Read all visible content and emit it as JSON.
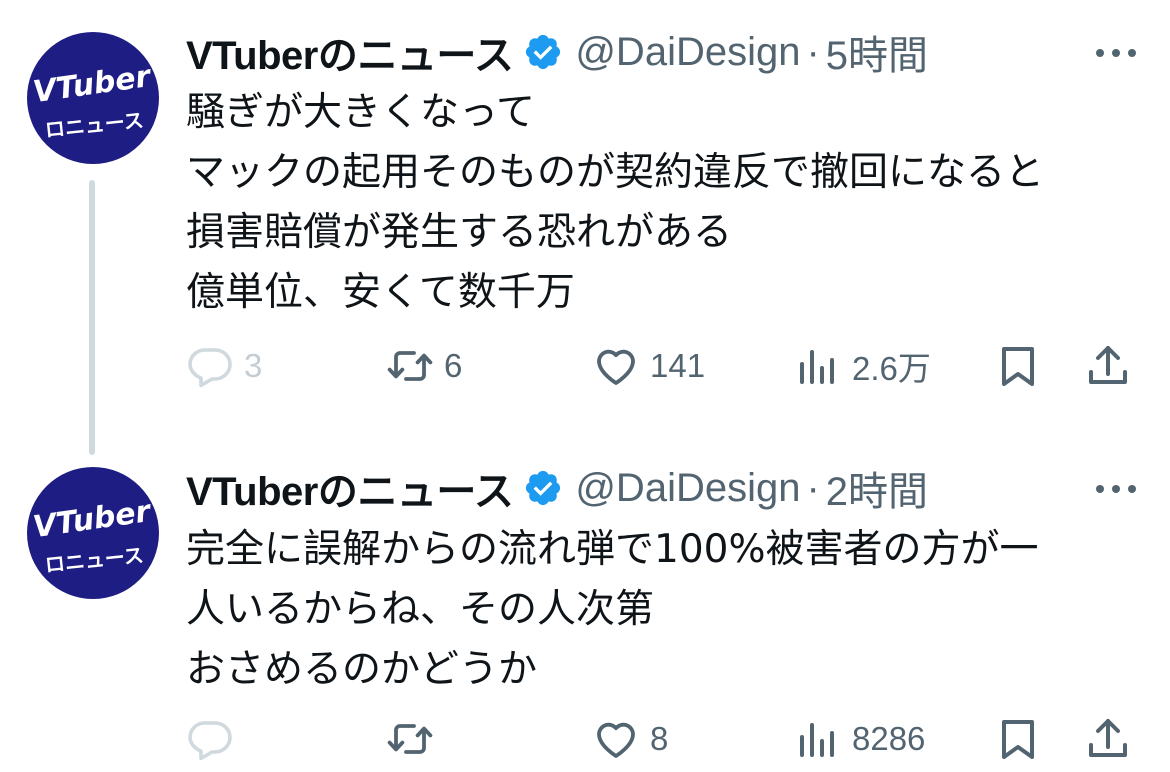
{
  "tweets": [
    {
      "avatar_text": {
        "line1": "VTuber",
        "line2": "ロニュース"
      },
      "author_name": "VTuberのニュース",
      "handle": "@DaiDesign",
      "separator": "·",
      "time": "5時間",
      "text_lines": [
        "騒ぎが大きくなって",
        "マックの起用そのものが契約違反で撤回になると",
        "損害賠償が発生する恐れがある",
        "億単位、安くて数千万"
      ],
      "actions": {
        "replies": "3",
        "retweets": "6",
        "likes": "141",
        "views": "2.6万"
      }
    },
    {
      "avatar_text": {
        "line1": "VTuber",
        "line2": "ロニュース"
      },
      "author_name": "VTuberのニュース",
      "handle": "@DaiDesign",
      "separator": "·",
      "time": "2時間",
      "text_lines": [
        "完全に誤解からの流れ弾で100%被害者の方が一",
        "人いるからね、その人次第",
        "おさめるのかどうか"
      ],
      "actions": {
        "replies": "",
        "retweets": "",
        "likes": "8",
        "views": "8286"
      }
    }
  ],
  "icons": {
    "verified": "verified-badge-icon",
    "more": "more-dots-icon",
    "reply": "reply-bubble-icon",
    "retweet": "retweet-icon",
    "like": "heart-icon",
    "views": "views-chart-icon",
    "bookmark": "bookmark-icon",
    "share": "share-icon"
  },
  "colors": {
    "text_primary": "#0f1419",
    "text_secondary": "#536471",
    "verified_blue": "#1d9bf0",
    "avatar_bg": "#1e1d84",
    "thread_line": "#cfd9de",
    "reply_disabled": "#cfd9de"
  }
}
